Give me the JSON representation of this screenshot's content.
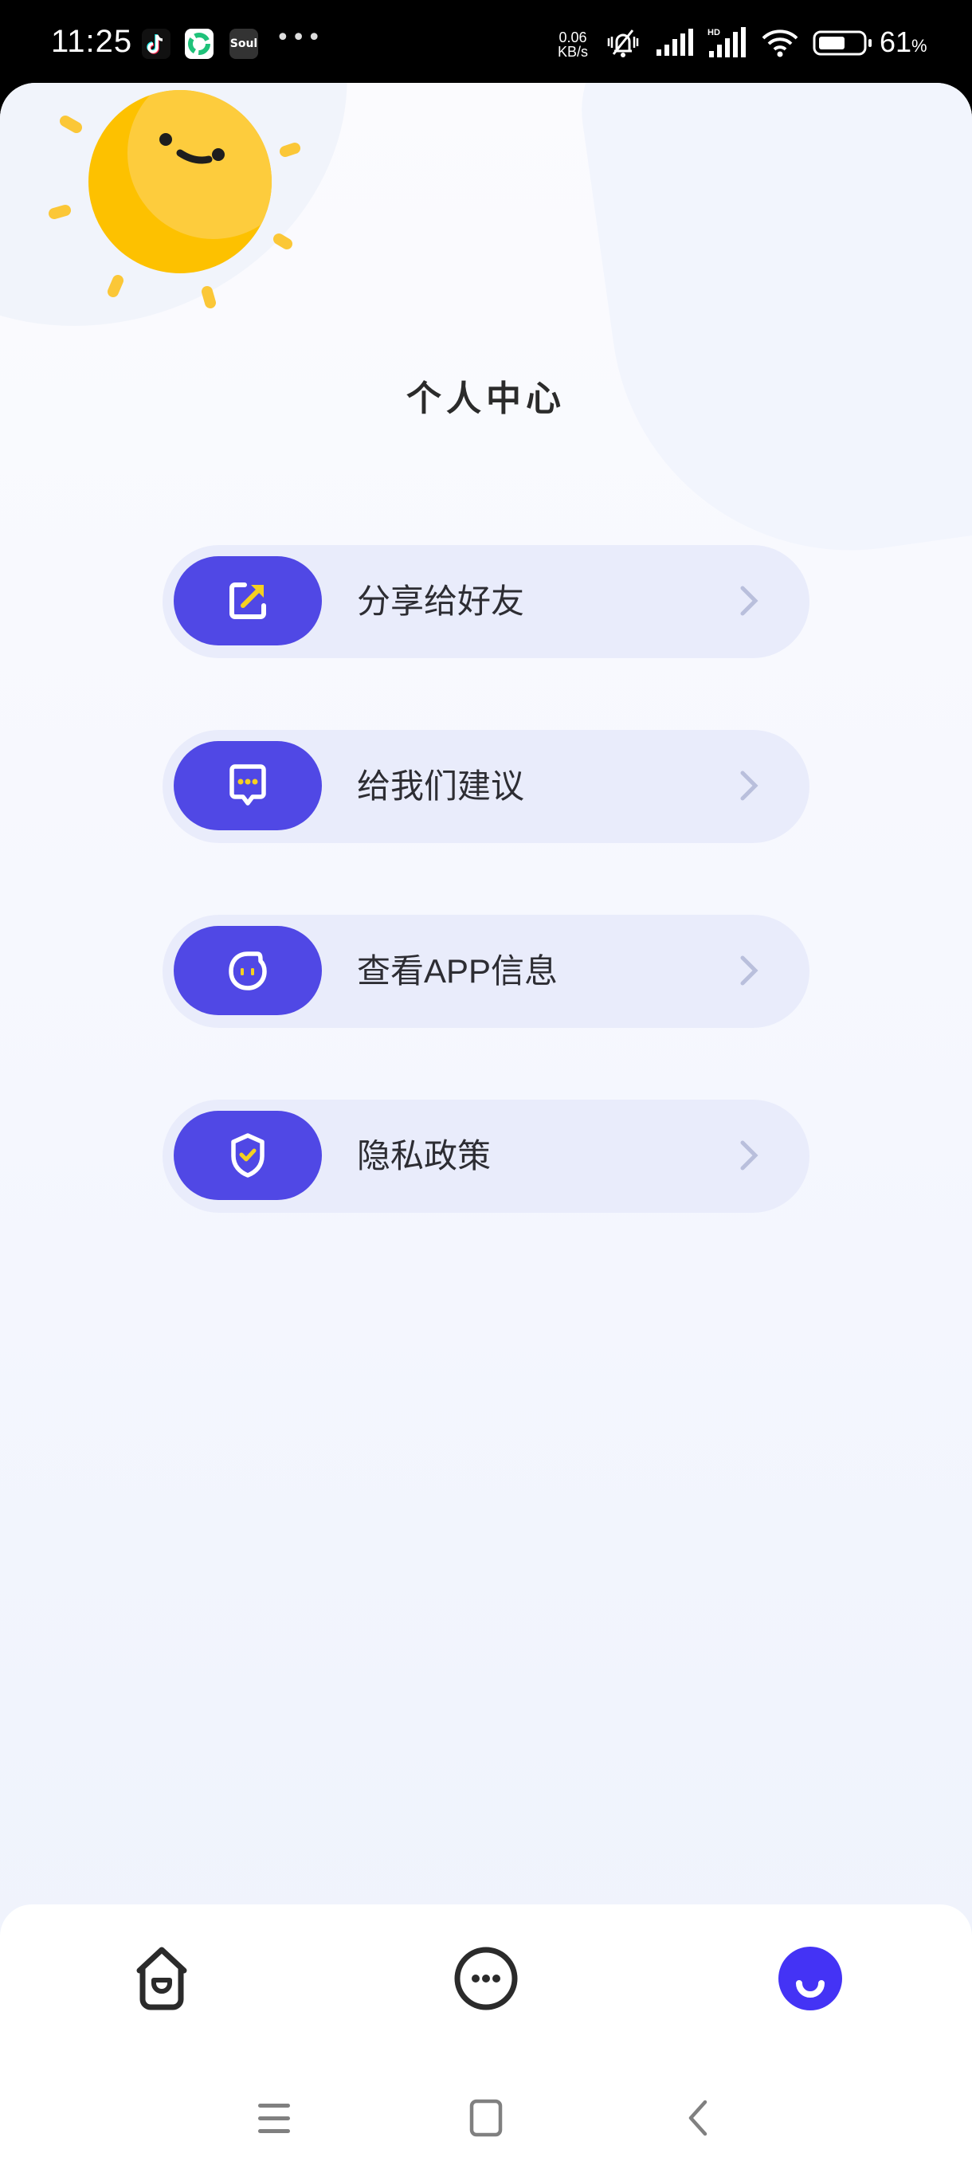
{
  "status_bar": {
    "time": "11:25",
    "notification_apps": [
      "tiktok",
      "green-app",
      "Soul"
    ],
    "soul_label": "Soul",
    "more_indicator": "•••",
    "network_speed_value": "0.06",
    "network_speed_unit": "KB/s",
    "battery_percent": "61",
    "battery_symbol": "%",
    "battery_level": 0.61
  },
  "page": {
    "title": "个人中心"
  },
  "menu": {
    "items": [
      {
        "label": "分享给好友",
        "icon": "share-icon"
      },
      {
        "label": "给我们建议",
        "icon": "feedback-icon"
      },
      {
        "label": "查看APP信息",
        "icon": "app-info-icon"
      },
      {
        "label": "隐私政策",
        "icon": "privacy-shield-icon"
      }
    ]
  },
  "tab_bar": {
    "tabs": [
      {
        "name": "home",
        "icon": "home-icon",
        "active": false
      },
      {
        "name": "more",
        "icon": "more-circle-icon",
        "active": false
      },
      {
        "name": "me",
        "icon": "smile-profile-icon",
        "active": true
      }
    ]
  },
  "colors": {
    "accent": "#5048e5",
    "tab_active": "#4433f5",
    "icon_highlight": "#f5d020",
    "item_bg": "#e9ecfb",
    "text": "#2d2d33",
    "sun": "#fdc100"
  }
}
